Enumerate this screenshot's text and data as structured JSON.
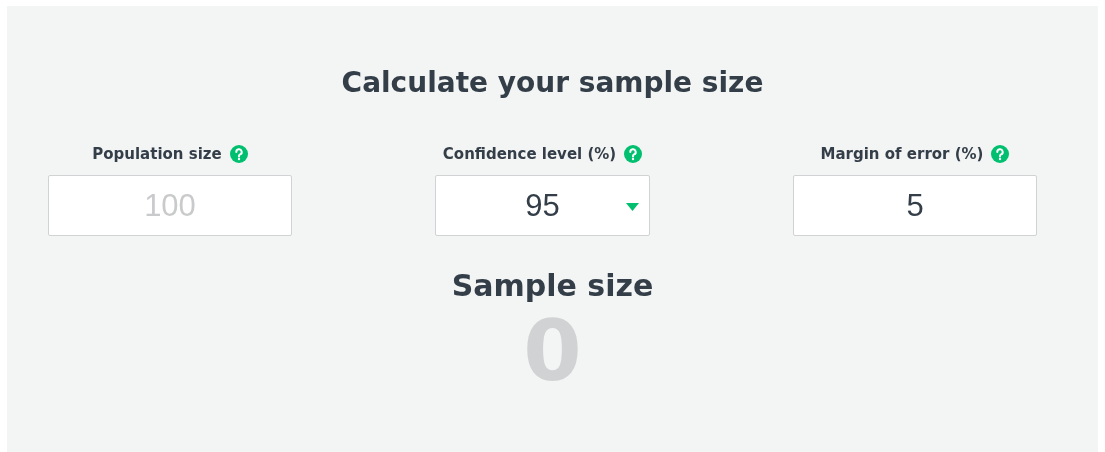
{
  "title": "Calculate your sample size",
  "fields": [
    {
      "label": "Population size",
      "kind": "input",
      "placeholder": "100"
    },
    {
      "label": "Confidence level (%)",
      "kind": "select",
      "value": "95"
    },
    {
      "label": "Margin of error (%)",
      "kind": "input",
      "value": "5"
    }
  ],
  "result": {
    "label": "Sample size",
    "value": "0"
  }
}
